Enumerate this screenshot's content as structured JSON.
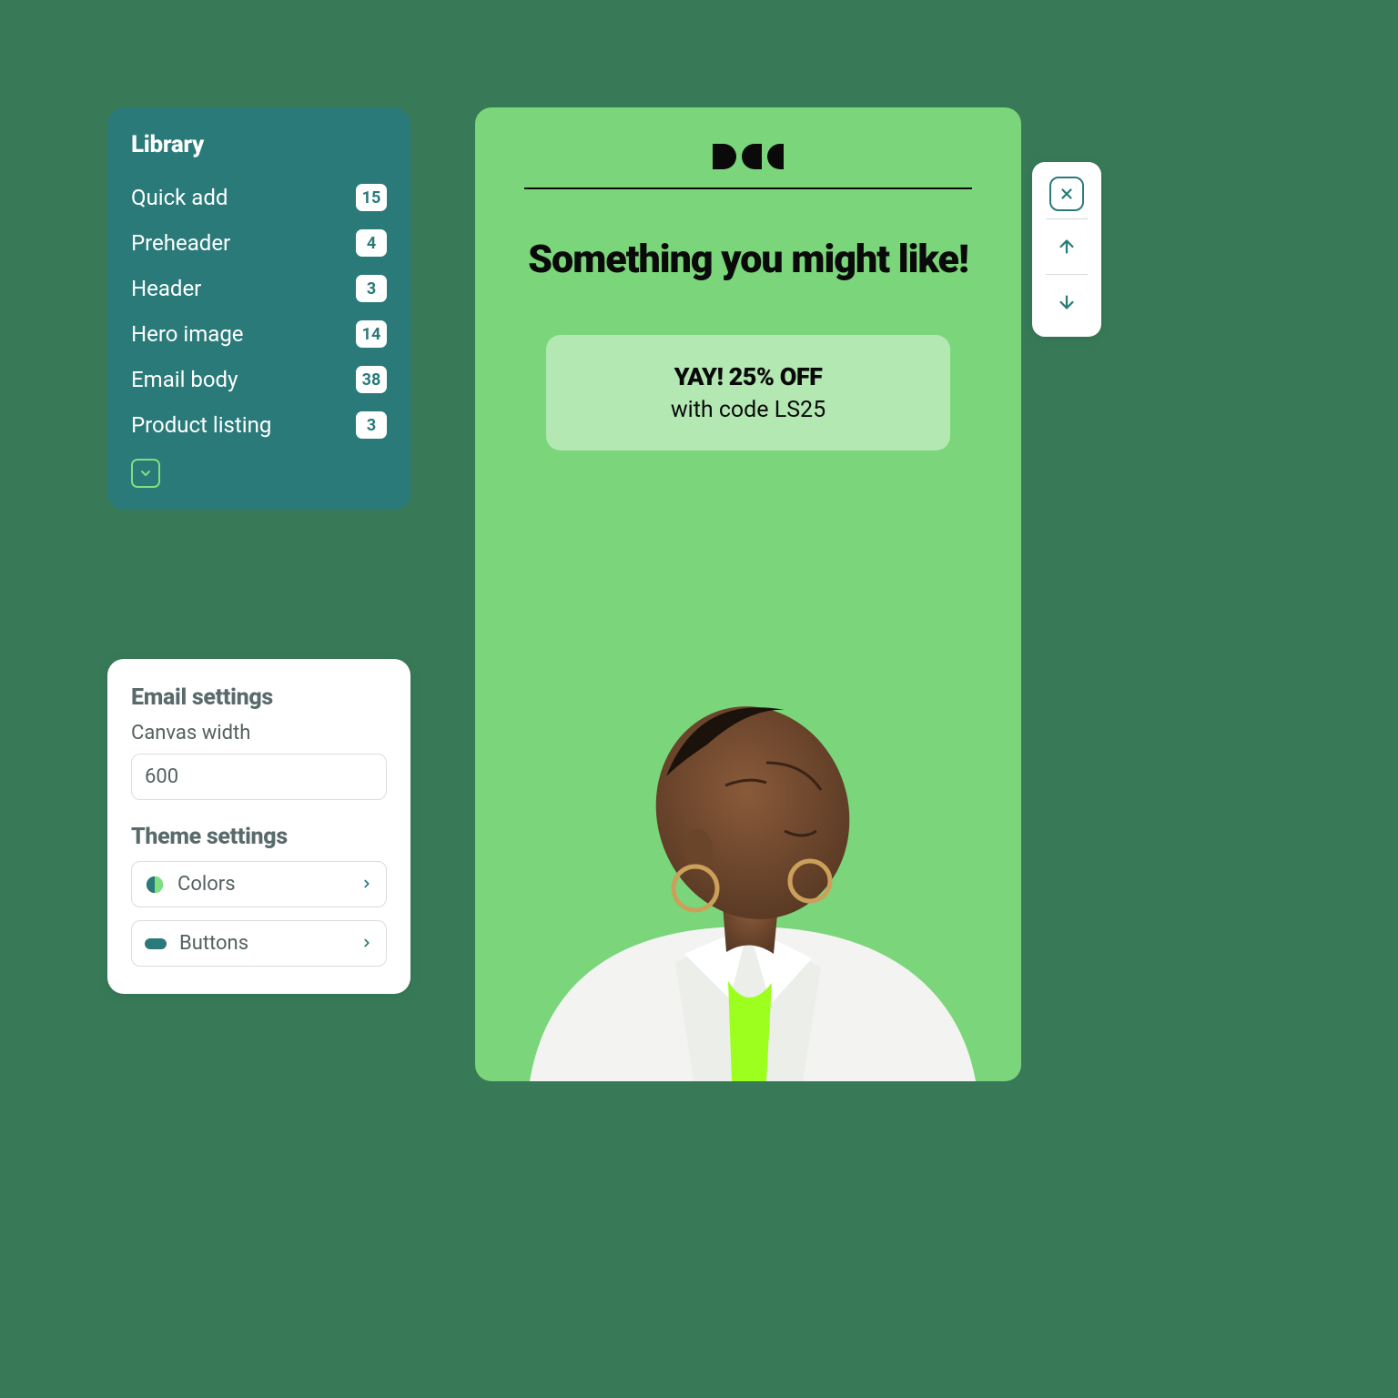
{
  "library": {
    "title": "Library",
    "items": [
      {
        "label": "Quick add",
        "count": "15"
      },
      {
        "label": "Preheader",
        "count": "4"
      },
      {
        "label": "Header",
        "count": "3"
      },
      {
        "label": "Hero image",
        "count": "14"
      },
      {
        "label": "Email body",
        "count": "38"
      },
      {
        "label": "Product listing",
        "count": "3"
      }
    ]
  },
  "settings": {
    "email_title": "Email settings",
    "canvas_label": "Canvas width",
    "canvas_value": "600",
    "theme_title": "Theme settings",
    "colors_label": "Colors",
    "buttons_label": "Buttons"
  },
  "preview": {
    "headline": "Something you might like!",
    "promo_headline": "YAY! 25% OFF",
    "promo_sub": "with code LS25"
  },
  "colors": {
    "teal": "#2a7a7a",
    "green": "#7bd67b",
    "lightgreen": "#b3e8b3"
  }
}
